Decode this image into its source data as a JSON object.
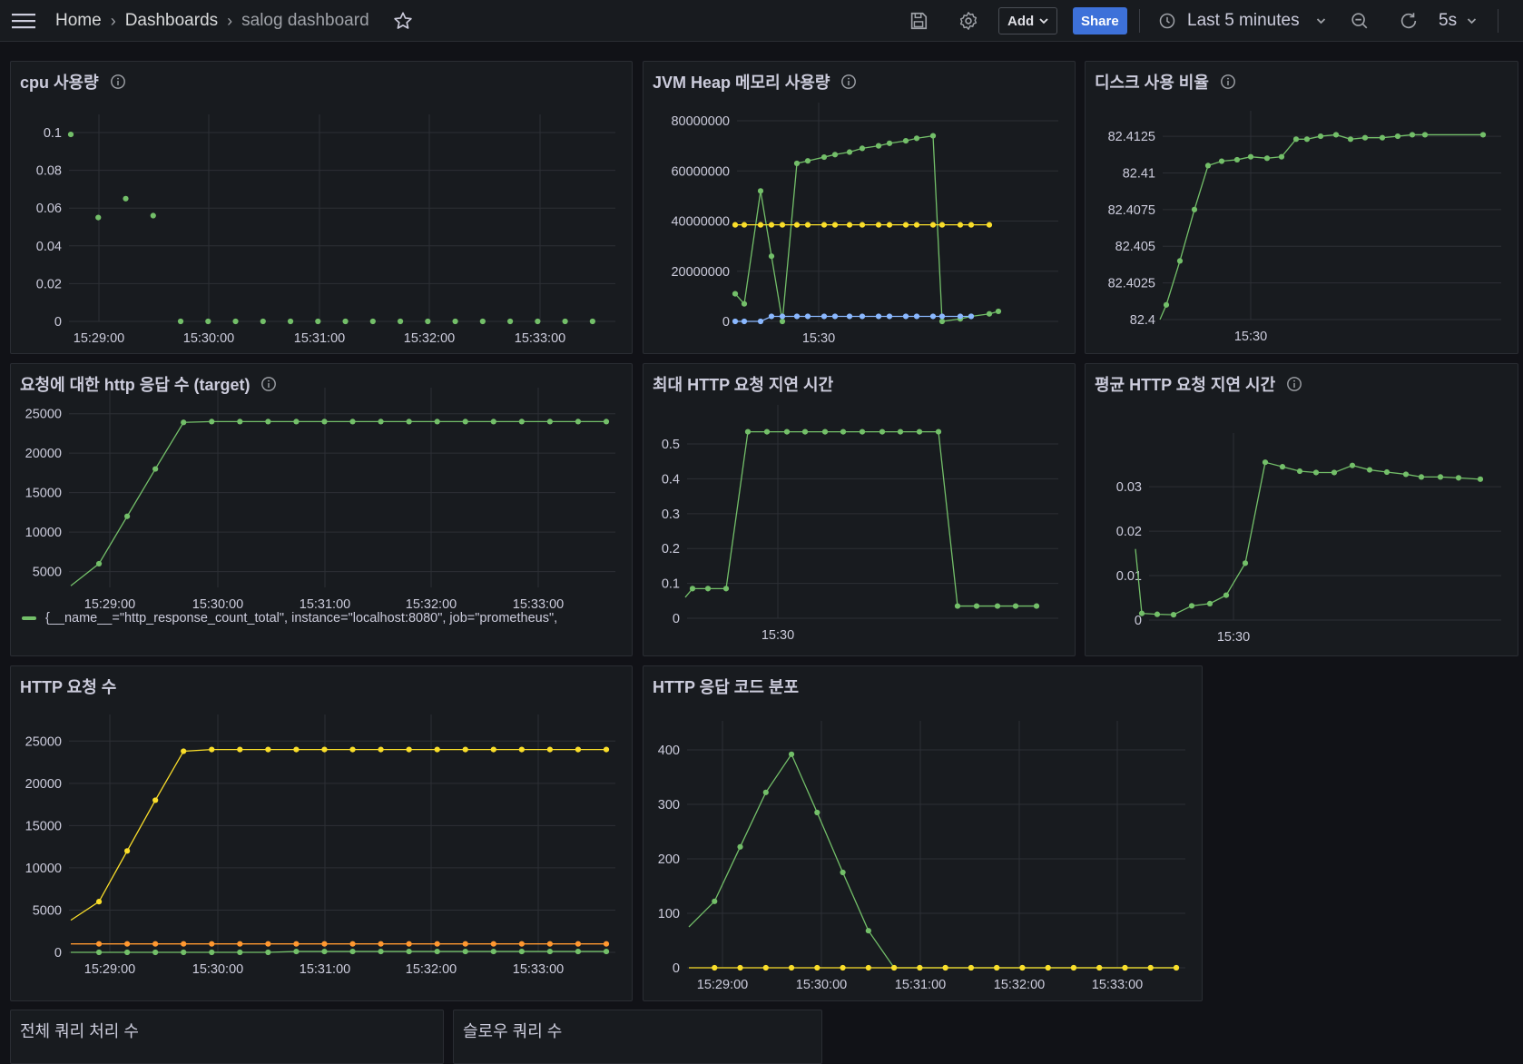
{
  "nav": {
    "breadcrumbs": [
      "Home",
      "Dashboards",
      "salog dashboard"
    ],
    "add_label": "Add",
    "share_label": "Share",
    "time_range": "Last 5 minutes",
    "refresh_interval": "5s"
  },
  "colors": {
    "green": "#73bf69",
    "yellow": "#fade2a",
    "blue": "#8ab8ff",
    "orange": "#ff9830",
    "share_button": "#3d71d9"
  },
  "panels": {
    "cpu": {
      "title": "cpu 사용량"
    },
    "jvm": {
      "title": "JVM Heap 메모리 사용량"
    },
    "disk": {
      "title": "디스크 사용 비율"
    },
    "http_target": {
      "title": "요청에 대한 http 응답 수 (target)",
      "legend": "{__name__=\"http_response_count_total\", instance=\"localhost:8080\", job=\"prometheus\","
    },
    "max_latency": {
      "title": "최대 HTTP 요청 지연 시간"
    },
    "avg_latency": {
      "title": "평균 HTTP 요청 지연 시간"
    },
    "http_requests": {
      "title": "HTTP 요청 수"
    },
    "http_codes": {
      "title": "HTTP 응답 코드 분포"
    },
    "total_queries": {
      "title": "전체 쿼리 처리 수"
    },
    "slow_queries": {
      "title": "슬로우 쿼리 수"
    }
  },
  "chart_data": [
    {
      "id": "cpu",
      "type": "scatter",
      "x_ticks": [
        "15:29:00",
        "15:30:00",
        "15:31:00",
        "15:32:00",
        "15:33:00"
      ],
      "y_ticks": [
        "0",
        "0.02",
        "0.04",
        "0.06",
        "0.08",
        "0.1"
      ],
      "ylim": [
        0,
        0.1
      ],
      "series": [
        {
          "color": "green",
          "points_mode": "points",
          "values": [
            0.099,
            null,
            0.055,
            null,
            0.065,
            null,
            0.056,
            null,
            0,
            null,
            0,
            null,
            0,
            null,
            0,
            null,
            0,
            null,
            0,
            null,
            0,
            null,
            0,
            null,
            0,
            null,
            0,
            null,
            0,
            null,
            0,
            null,
            0,
            null,
            0,
            null,
            0,
            null,
            0,
            null
          ]
        }
      ]
    },
    {
      "id": "jvm",
      "type": "line",
      "x_ticks": [
        "15:30"
      ],
      "y_ticks": [
        "0",
        "20000000",
        "40000000",
        "60000000",
        "80000000"
      ],
      "ylim": [
        0,
        80000000
      ],
      "series": [
        {
          "color": "green",
          "values": [
            11000000,
            7000000,
            52000000,
            26000000,
            0,
            63000000,
            64000000,
            65500000,
            66500000,
            67500000,
            69000000,
            70000000,
            71000000,
            72000000,
            73000000,
            74000000,
            0,
            1000000,
            2000000,
            3000000,
            4000000
          ]
        },
        {
          "color": "yellow",
          "values": [
            38500000,
            38500000,
            38500000,
            38500000,
            38500000,
            38500000,
            38500000,
            38500000,
            38500000,
            38500000,
            38500000,
            38500000,
            38500000,
            38500000,
            38500000,
            38500000,
            38500000,
            38500000,
            38500000,
            38500000
          ]
        },
        {
          "color": "blue",
          "values": [
            0,
            0,
            0,
            2000000,
            2000000,
            2000000,
            2000000,
            2000000,
            2000000,
            2000000,
            2000000,
            2000000,
            2000000,
            2000000,
            2000000,
            2000000,
            2000000,
            2000000,
            2000000
          ]
        }
      ]
    },
    {
      "id": "disk",
      "type": "line",
      "x_ticks": [
        "15:30"
      ],
      "y_ticks": [
        "82.4",
        "82.4025",
        "82.405",
        "82.4075",
        "82.41",
        "82.4125"
      ],
      "ylim": [
        82.4,
        82.413
      ],
      "series": [
        {
          "color": "green",
          "values": [
            82.4,
            82.401,
            82.404,
            82.4075,
            82.4105,
            82.4108,
            82.4109,
            82.4111,
            82.411,
            82.4111,
            82.4123,
            82.4123,
            82.4125,
            82.4126,
            82.4123,
            82.4124,
            82.4124,
            82.4125,
            82.4126,
            82.4126,
            82.4126
          ]
        }
      ]
    },
    {
      "id": "http_target",
      "type": "line",
      "x_ticks": [
        "15:29:00",
        "15:30:00",
        "15:31:00",
        "15:32:00",
        "15:33:00"
      ],
      "y_ticks": [
        "5000",
        "10000",
        "15000",
        "20000",
        "25000"
      ],
      "ylim": [
        3000,
        26000
      ],
      "series": [
        {
          "color": "green",
          "values": [
            3200,
            6000,
            12000,
            18000,
            23900,
            24000,
            24000,
            24000,
            24000,
            24000,
            24000,
            24000,
            24000,
            24000,
            24000,
            24000,
            24000,
            24000,
            24000,
            24000
          ]
        }
      ]
    },
    {
      "id": "max_latency",
      "type": "line",
      "x_ticks": [
        "15:30"
      ],
      "y_ticks": [
        "0",
        "0.1",
        "0.2",
        "0.3",
        "0.4",
        "0.5"
      ],
      "ylim": [
        0,
        0.56
      ],
      "series": [
        {
          "color": "green",
          "values": [
            0.06,
            0.085,
            0.085,
            0.085,
            0.535,
            0.535,
            0.535,
            0.535,
            0.535,
            0.535,
            0.535,
            0.535,
            0.535,
            0.535,
            0.535,
            0.035,
            0.035,
            0.035,
            0.035,
            0.035
          ]
        }
      ]
    },
    {
      "id": "avg_latency",
      "type": "line",
      "x_ticks": [
        "15:30"
      ],
      "y_ticks": [
        "0",
        "0.01",
        "0.02",
        "0.03"
      ],
      "ylim": [
        0,
        0.038
      ],
      "series": [
        {
          "color": "green",
          "values": [
            0.016,
            0.0015,
            0.0013,
            0.0012,
            0.0032,
            0.0037,
            0.0056,
            0.0128,
            0.0355,
            0.0345,
            0.0335,
            0.0332,
            0.0332,
            0.0348,
            0.0338,
            0.0333,
            0.0328,
            0.0322,
            0.0322,
            0.032,
            0.0317
          ]
        }
      ]
    },
    {
      "id": "http_requests",
      "type": "line",
      "x_ticks": [
        "15:29:00",
        "15:30:00",
        "15:31:00",
        "15:32:00",
        "15:33:00"
      ],
      "y_ticks": [
        "0",
        "5000",
        "10000",
        "15000",
        "20000",
        "25000"
      ],
      "ylim": [
        0,
        26000
      ],
      "series": [
        {
          "color": "yellow",
          "values": [
            3800,
            6000,
            12000,
            18000,
            23800,
            24000,
            24000,
            24000,
            24000,
            24000,
            24000,
            24000,
            24000,
            24000,
            24000,
            24000,
            24000,
            24000,
            24000,
            24000
          ]
        },
        {
          "color": "orange",
          "values": [
            1000,
            1000,
            1000,
            1000,
            1000,
            1000,
            1000,
            1000,
            1000,
            1000,
            1000,
            1000,
            1000,
            1000,
            1000,
            1000,
            1000,
            1000,
            1000,
            1000
          ]
        },
        {
          "color": "green",
          "values": [
            0,
            0,
            0,
            0,
            0,
            0,
            0,
            0,
            100,
            100,
            100,
            100,
            100,
            100,
            100,
            100,
            100,
            100,
            100,
            100
          ]
        }
      ]
    },
    {
      "id": "http_codes",
      "type": "line",
      "x_ticks": [
        "15:29:00",
        "15:30:00",
        "15:31:00",
        "15:32:00",
        "15:33:00"
      ],
      "y_ticks": [
        "0",
        "100",
        "200",
        "300",
        "400"
      ],
      "ylim": [
        0,
        420
      ],
      "series": [
        {
          "color": "green",
          "values": [
            75,
            122,
            222,
            322,
            392,
            285,
            175,
            68,
            0,
            0,
            0,
            0,
            0,
            0,
            0,
            0,
            0,
            0,
            0,
            0
          ]
        },
        {
          "color": "yellow",
          "values": [
            0,
            0,
            0,
            0,
            0,
            0,
            0,
            0,
            0,
            0,
            0,
            0,
            0,
            0,
            0,
            0,
            0,
            0,
            0,
            0
          ]
        }
      ]
    }
  ]
}
